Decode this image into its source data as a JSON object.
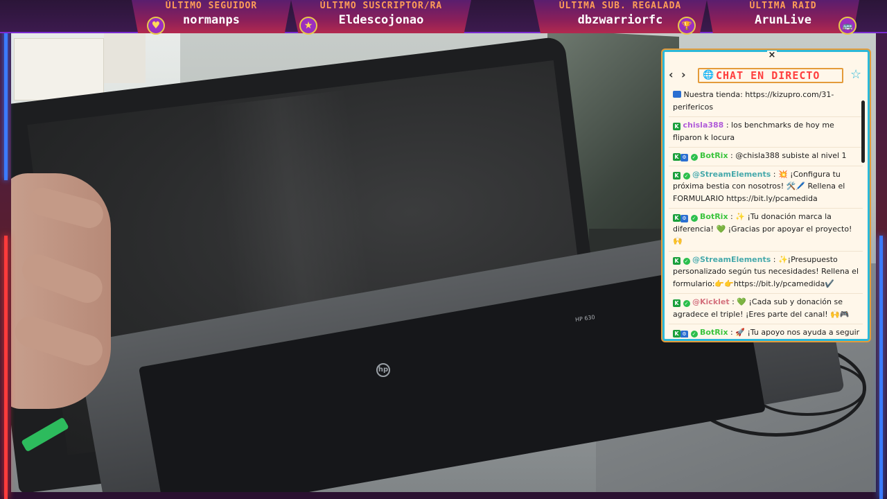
{
  "banner": [
    {
      "label": "ÚLTIMo SEGUIDoR",
      "value": "normanps",
      "icon": "heart-icon",
      "glyph": "♥"
    },
    {
      "label": "ÚLTIMo SUSCRIPTOR/RA",
      "value": "Eldescojonao",
      "icon": "star-icon",
      "glyph": "★"
    },
    {
      "label": "ÚLTIMA SUB. REGALADA",
      "value": "dbzwarriorfc",
      "icon": "trophy-icon",
      "glyph": "🏆"
    },
    {
      "label": "ÚLTIMA RAID",
      "value": "ArunLive",
      "icon": "bus-icon",
      "glyph": "🚌"
    }
  ],
  "device": {
    "brand_glyph": "hp",
    "model": "HP 630"
  },
  "chat": {
    "title": "CHAT EN DIRECTO",
    "close_glyph": "×",
    "prev_glyph": "‹",
    "next_glyph": "›",
    "messages": [
      {
        "user": "",
        "text": "Nuestra tienda: https://kizupro.com/31-perifericos"
      },
      {
        "user": "chisla388",
        "text": "los benchmarks de hoy me fliparon k locura"
      },
      {
        "user": "BotRix",
        "text": "@chisla388 subiste al nivel 1"
      },
      {
        "user": "@StreamElements",
        "text": "💥 ¡Configura tu próxima bestia con nosotros! 🛠️🖊️ Rellena el FORMULARIO https://bit.ly/pcamedida"
      },
      {
        "user": "BotRix",
        "text": "✨ ¡Tu donación marca la diferencia! 💚 ¡Gracias por apoyar el proyecto! 🙌"
      },
      {
        "user": "@StreamElements",
        "text": "✨¡Presupuesto personalizado según tus necesidades! Rellena el formulario:👉👉https://bit.ly/pcamedida✔️"
      },
      {
        "user": "@Kicklet",
        "text": "💚 ¡Cada sub y donación se agradece el triple! ¡Eres parte del canal! 🙌🎮"
      },
      {
        "user": "BotRix",
        "text": "🚀 ¡Tu apoyo nos ayuda a seguir creando contenido épico! 💻❤️"
      }
    ]
  },
  "colors": {
    "accent": "#2bb8d9",
    "title_red": "#ff3e3e",
    "banner_label": "#ff9d57"
  }
}
